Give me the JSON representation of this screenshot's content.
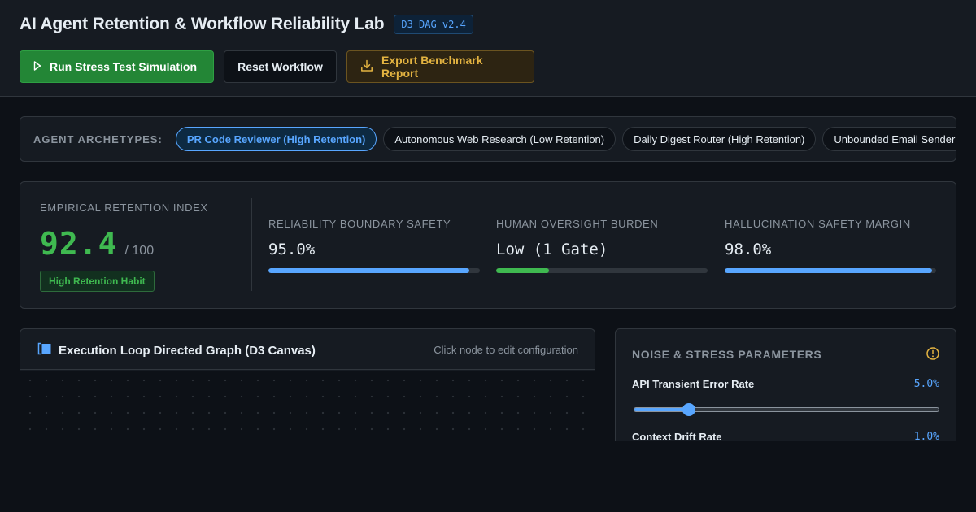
{
  "header": {
    "title": "AI Agent Retention & Workflow Reliability Lab",
    "version_badge": "D3 DAG v2.4",
    "run_button": "Run Stress Test Simulation",
    "reset_button": "Reset Workflow",
    "export_button": "Export Benchmark Report"
  },
  "archetypes": {
    "label": "AGENT ARCHETYPES:",
    "items": [
      {
        "label": "PR Code Reviewer (High Retention)",
        "active": true
      },
      {
        "label": "Autonomous Web Research (Low Retention)",
        "active": false
      },
      {
        "label": "Daily Digest Router (High Retention)",
        "active": false
      },
      {
        "label": "Unbounded Email Sender (Medium Retention)",
        "active": false
      }
    ]
  },
  "retention": {
    "label": "EMPIRICAL RETENTION INDEX",
    "value": "92.4",
    "max": "/ 100",
    "badge": "High Retention Habit"
  },
  "metrics": [
    {
      "label": "RELIABILITY BOUNDARY SAFETY",
      "value": "95.0%",
      "fill": 0.95,
      "color": "#58a6ff"
    },
    {
      "label": "HUMAN OVERSIGHT BURDEN",
      "value": "Low (1 Gate)",
      "fill": 0.25,
      "color": "#3fb950"
    },
    {
      "label": "HALLUCINATION SAFETY MARGIN",
      "value": "98.0%",
      "fill": 0.98,
      "color": "#58a6ff"
    }
  ],
  "graph": {
    "title": "Execution Loop Directed Graph (D3 Canvas)",
    "hint": "Click node to edit configuration"
  },
  "params": {
    "title": "NOISE & STRESS PARAMETERS",
    "api_error": {
      "label": "API Transient Error Rate",
      "value": "5.0%",
      "slider": 0.18
    },
    "context_drift": {
      "label": "Context Drift Rate",
      "value": "1.0%"
    }
  },
  "colors": {
    "accent": "#58a6ff",
    "success": "#3fb950",
    "warning": "#e3b341",
    "primary_button": "#238636"
  },
  "icons": {
    "run": "play-icon",
    "export": "download-icon",
    "graph": "graph-canvas-icon",
    "params": "warning-circle-icon"
  }
}
